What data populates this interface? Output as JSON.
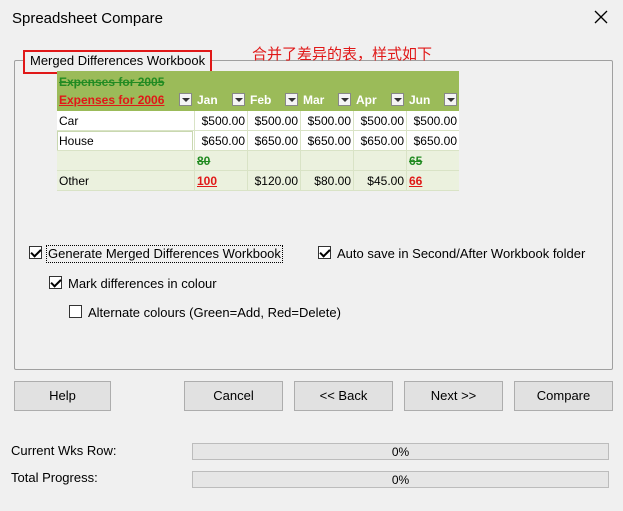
{
  "window": {
    "title": "Spreadsheet Compare",
    "close_icon": "close-icon"
  },
  "group": {
    "legend": "Merged Differences Workbook"
  },
  "annotation": "合并了差异的表，样式如下",
  "preview": {
    "header_old": "Expenses for 2005",
    "header_new": "Expenses for 2006",
    "months": [
      "Jan",
      "Feb",
      "Mar",
      "Apr",
      "Jun"
    ],
    "rows": {
      "car": {
        "label": "Car",
        "values": [
          "$500.00",
          "$500.00",
          "$500.00",
          "$500.00",
          "$500.00"
        ]
      },
      "house": {
        "label": "House",
        "values": [
          "$650.00",
          "$650.00",
          "$650.00",
          "$650.00",
          "$650.00"
        ]
      },
      "other": {
        "label": "Other",
        "old_jan": "80",
        "new_jan": "100",
        "feb": "$120.00",
        "mar": "$80.00",
        "apr": "$45.00",
        "old_jun": "65",
        "new_jun": "66"
      }
    },
    "colors": {
      "header_bg": "#9bbb59",
      "added": "#228b22",
      "deleted": "#e01818"
    }
  },
  "options": {
    "generate_merged": {
      "label": "Generate Merged Differences Workbook",
      "checked": true
    },
    "auto_save": {
      "label": "Auto save in Second/After Workbook folder",
      "checked": true
    },
    "mark_diffs": {
      "label": "Mark differences in colour",
      "checked": true
    },
    "alternate_colours": {
      "label": "Alternate colours (Green=Add, Red=Delete)",
      "checked": false
    }
  },
  "buttons": {
    "help": "Help",
    "cancel": "Cancel",
    "back": "<< Back",
    "next": "Next >>",
    "compare": "Compare"
  },
  "progress": {
    "current_label": "Current Wks Row:",
    "current_value": "0%",
    "current_fraction": 0,
    "total_label": "Total Progress:",
    "total_value": "0%",
    "total_fraction": 0
  }
}
